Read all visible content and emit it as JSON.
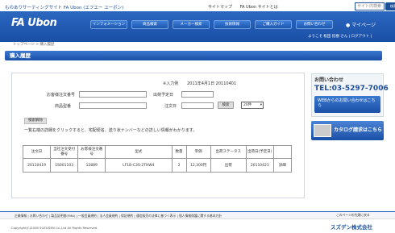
{
  "header": {
    "tagline": "ものありサーティングサイト FA Ubon (エフエー ユーボン)",
    "sitemap": "サイトマップ",
    "fa_ubon_top": "FA Ubon サイトとは",
    "search_placeholder": "サイト内検索",
    "search_button": "検索",
    "logo": "FA Ubon",
    "nav": [
      "インフォメーション",
      "商品検索",
      "メーカー検索",
      "技術情報",
      "ご購入ガイド",
      "お問い合わせ"
    ],
    "mypage": "マイページ",
    "welcome": "ようこそ 松田 稔樹 さん | ログアウト |"
  },
  "breadcrumb": "トップページ > 購入履歴",
  "page_title": "購入履歴",
  "form": {
    "entry_date_label": "入力例",
    "entry_date_example": "2011年4月1日  20110401",
    "customer_order_label": "お客様注文番号",
    "ship_date_label": "出荷予定日",
    "product_model_label": "商品型番",
    "order_date_label": "注文日",
    "search_button": "検索",
    "per_page_value": "20件",
    "reset_button": "検索解除",
    "note": "一覧右端の詳細をクリックすると、宅配便名、送り状ナンバーなどの詳しい情報がわかります。"
  },
  "table": {
    "headers": [
      "注文日",
      "当社注文受付番号",
      "お客様注文番号",
      "型式",
      "数量",
      "単価",
      "出荷ステータス",
      "出荷日(予定日)",
      ""
    ],
    "rows": [
      [
        "20110419",
        "1S001103",
        "12889",
        "LF1B-C3S-2THW4",
        "2",
        "12,300円",
        "出荷",
        "20110423",
        "詳細"
      ]
    ]
  },
  "sidebar": {
    "contact_title": "お問い合わせ",
    "phone": "TEL:03-5297-7006",
    "web_banner": "WEBからのお問い合わせはこちら",
    "catalog_banner": "カタログ請求はこちら"
  },
  "footer": {
    "links": "企業情報 | お問い合わせ | 製品証明書(FMA) | 一般会員規約 | 法人会員規約 | 保証規約 | 通信販売の法律に基づく表示 | 個人情報保護に関する基本方針",
    "page_top": "このページの先頭に戻る",
    "copyright": "Copyright(C)2008 SUZUDEN Co.,Ltd All Rights Reserved.",
    "company": "スズデン株式会社"
  }
}
